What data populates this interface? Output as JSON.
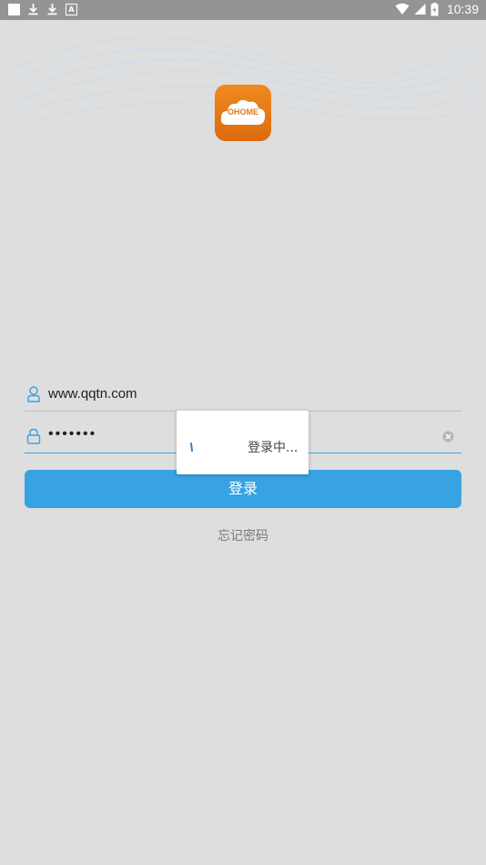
{
  "status_bar": {
    "time": "10:39",
    "left_icons": [
      "notification-square-icon",
      "download-icon",
      "download-icon",
      "a-box-icon"
    ],
    "right_icons": [
      "wifi-icon",
      "signal-icon",
      "battery-icon"
    ]
  },
  "logo": {
    "text": "OHOME",
    "color": "#e9821c"
  },
  "username": {
    "value": "www.qqtn.com",
    "icon": "user-icon"
  },
  "password": {
    "value": "•••••••",
    "icon": "lock-icon",
    "clear_icon": "clear-icon"
  },
  "login_button": {
    "label": "登录",
    "color": "#38a3e2"
  },
  "forgot_link": {
    "label": "忘记密码"
  },
  "loading_dialog": {
    "message": "登录中..."
  }
}
